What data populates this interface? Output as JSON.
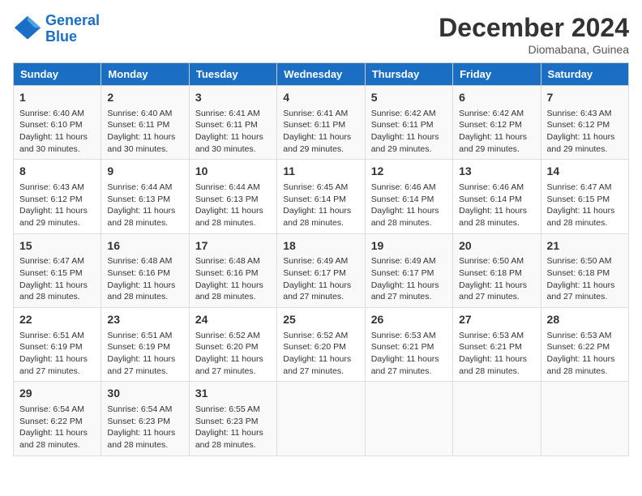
{
  "logo": {
    "line1": "General",
    "line2": "Blue"
  },
  "title": "December 2024",
  "subtitle": "Diomabana, Guinea",
  "days_of_week": [
    "Sunday",
    "Monday",
    "Tuesday",
    "Wednesday",
    "Thursday",
    "Friday",
    "Saturday"
  ],
  "weeks": [
    [
      {
        "day": "1",
        "sunrise": "6:40 AM",
        "sunset": "6:10 PM",
        "daylight": "11 hours and 30 minutes."
      },
      {
        "day": "2",
        "sunrise": "6:40 AM",
        "sunset": "6:11 PM",
        "daylight": "11 hours and 30 minutes."
      },
      {
        "day": "3",
        "sunrise": "6:41 AM",
        "sunset": "6:11 PM",
        "daylight": "11 hours and 30 minutes."
      },
      {
        "day": "4",
        "sunrise": "6:41 AM",
        "sunset": "6:11 PM",
        "daylight": "11 hours and 29 minutes."
      },
      {
        "day": "5",
        "sunrise": "6:42 AM",
        "sunset": "6:11 PM",
        "daylight": "11 hours and 29 minutes."
      },
      {
        "day": "6",
        "sunrise": "6:42 AM",
        "sunset": "6:12 PM",
        "daylight": "11 hours and 29 minutes."
      },
      {
        "day": "7",
        "sunrise": "6:43 AM",
        "sunset": "6:12 PM",
        "daylight": "11 hours and 29 minutes."
      }
    ],
    [
      {
        "day": "8",
        "sunrise": "6:43 AM",
        "sunset": "6:12 PM",
        "daylight": "11 hours and 29 minutes."
      },
      {
        "day": "9",
        "sunrise": "6:44 AM",
        "sunset": "6:13 PM",
        "daylight": "11 hours and 28 minutes."
      },
      {
        "day": "10",
        "sunrise": "6:44 AM",
        "sunset": "6:13 PM",
        "daylight": "11 hours and 28 minutes."
      },
      {
        "day": "11",
        "sunrise": "6:45 AM",
        "sunset": "6:14 PM",
        "daylight": "11 hours and 28 minutes."
      },
      {
        "day": "12",
        "sunrise": "6:46 AM",
        "sunset": "6:14 PM",
        "daylight": "11 hours and 28 minutes."
      },
      {
        "day": "13",
        "sunrise": "6:46 AM",
        "sunset": "6:14 PM",
        "daylight": "11 hours and 28 minutes."
      },
      {
        "day": "14",
        "sunrise": "6:47 AM",
        "sunset": "6:15 PM",
        "daylight": "11 hours and 28 minutes."
      }
    ],
    [
      {
        "day": "15",
        "sunrise": "6:47 AM",
        "sunset": "6:15 PM",
        "daylight": "11 hours and 28 minutes."
      },
      {
        "day": "16",
        "sunrise": "6:48 AM",
        "sunset": "6:16 PM",
        "daylight": "11 hours and 28 minutes."
      },
      {
        "day": "17",
        "sunrise": "6:48 AM",
        "sunset": "6:16 PM",
        "daylight": "11 hours and 28 minutes."
      },
      {
        "day": "18",
        "sunrise": "6:49 AM",
        "sunset": "6:17 PM",
        "daylight": "11 hours and 27 minutes."
      },
      {
        "day": "19",
        "sunrise": "6:49 AM",
        "sunset": "6:17 PM",
        "daylight": "11 hours and 27 minutes."
      },
      {
        "day": "20",
        "sunrise": "6:50 AM",
        "sunset": "6:18 PM",
        "daylight": "11 hours and 27 minutes."
      },
      {
        "day": "21",
        "sunrise": "6:50 AM",
        "sunset": "6:18 PM",
        "daylight": "11 hours and 27 minutes."
      }
    ],
    [
      {
        "day": "22",
        "sunrise": "6:51 AM",
        "sunset": "6:19 PM",
        "daylight": "11 hours and 27 minutes."
      },
      {
        "day": "23",
        "sunrise": "6:51 AM",
        "sunset": "6:19 PM",
        "daylight": "11 hours and 27 minutes."
      },
      {
        "day": "24",
        "sunrise": "6:52 AM",
        "sunset": "6:20 PM",
        "daylight": "11 hours and 27 minutes."
      },
      {
        "day": "25",
        "sunrise": "6:52 AM",
        "sunset": "6:20 PM",
        "daylight": "11 hours and 27 minutes."
      },
      {
        "day": "26",
        "sunrise": "6:53 AM",
        "sunset": "6:21 PM",
        "daylight": "11 hours and 27 minutes."
      },
      {
        "day": "27",
        "sunrise": "6:53 AM",
        "sunset": "6:21 PM",
        "daylight": "11 hours and 28 minutes."
      },
      {
        "day": "28",
        "sunrise": "6:53 AM",
        "sunset": "6:22 PM",
        "daylight": "11 hours and 28 minutes."
      }
    ],
    [
      {
        "day": "29",
        "sunrise": "6:54 AM",
        "sunset": "6:22 PM",
        "daylight": "11 hours and 28 minutes."
      },
      {
        "day": "30",
        "sunrise": "6:54 AM",
        "sunset": "6:23 PM",
        "daylight": "11 hours and 28 minutes."
      },
      {
        "day": "31",
        "sunrise": "6:55 AM",
        "sunset": "6:23 PM",
        "daylight": "11 hours and 28 minutes."
      },
      null,
      null,
      null,
      null
    ]
  ]
}
